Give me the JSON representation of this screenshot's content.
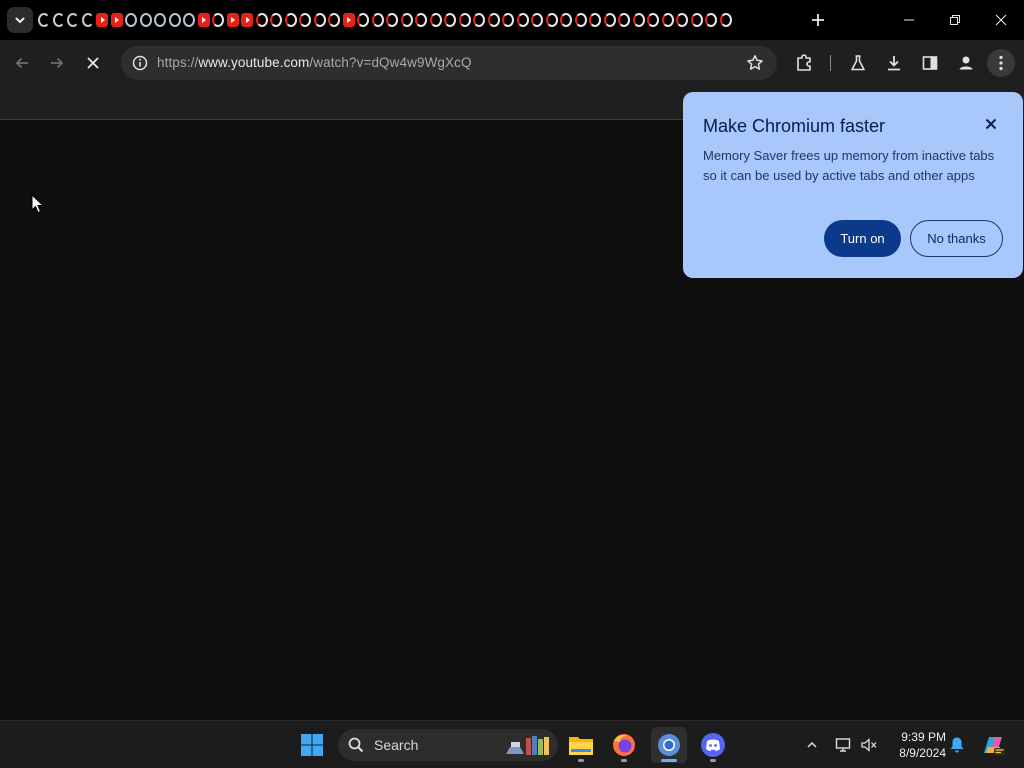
{
  "browser": {
    "tabs_favicons": [
      "spin",
      "spin",
      "spin",
      "spin",
      "yt",
      "yt",
      "globe",
      "globe",
      "globe",
      "globe",
      "globe",
      "yt",
      "spin-red",
      "yt",
      "yt",
      "spin-red",
      "spin-red",
      "spin-red",
      "spin-red",
      "spin-red",
      "spin-red",
      "yt",
      "spin-red",
      "spin-red",
      "spin-red",
      "spin-red",
      "spin-red",
      "spin-red",
      "spin-red",
      "spin-red",
      "spin-red",
      "spin-red",
      "spin-red",
      "spin-red",
      "spin-red",
      "spin-red",
      "spin-red",
      "spin-red",
      "spin-red",
      "spin-red",
      "spin-red",
      "spin-red",
      "spin-red",
      "spin-red",
      "spin-red",
      "spin-red",
      "spin-red",
      "spin-red"
    ],
    "url_prefix": "https://",
    "url_host": "www.youtube.com",
    "url_path": "/watch?v=dQw4w9WgXcQ"
  },
  "promo": {
    "title": "Make Chromium faster",
    "body": "Memory Saver frees up memory from inactive tabs so it can be used by active tabs and other apps",
    "primary_label": "Turn on",
    "secondary_label": "No thanks"
  },
  "taskbar": {
    "search_label": "Search",
    "time": "9:39 PM",
    "date": "8/9/2024"
  },
  "colors": {
    "bubble": "#a8c7fa",
    "primary_button": "#0b3a8a",
    "youtube_red": "#e62117"
  }
}
